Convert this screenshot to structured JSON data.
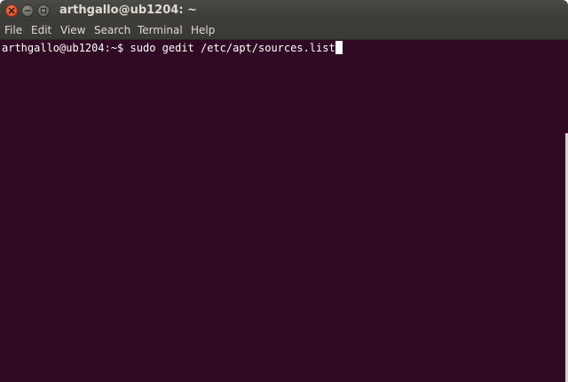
{
  "window": {
    "title": "arthgallo@ub1204: ~"
  },
  "controls": {
    "close_icon": "close-icon",
    "minimize_icon": "minimize-icon",
    "maximize_icon": "maximize-icon"
  },
  "menubar": {
    "items": [
      "File",
      "Edit",
      "View",
      "Search",
      "Terminal",
      "Help"
    ]
  },
  "terminal": {
    "prompt": "arthgallo@ub1204:~$",
    "command": "sudo gedit /etc/apt/sources.list",
    "background": "#300a24",
    "foreground": "#ffffff"
  }
}
